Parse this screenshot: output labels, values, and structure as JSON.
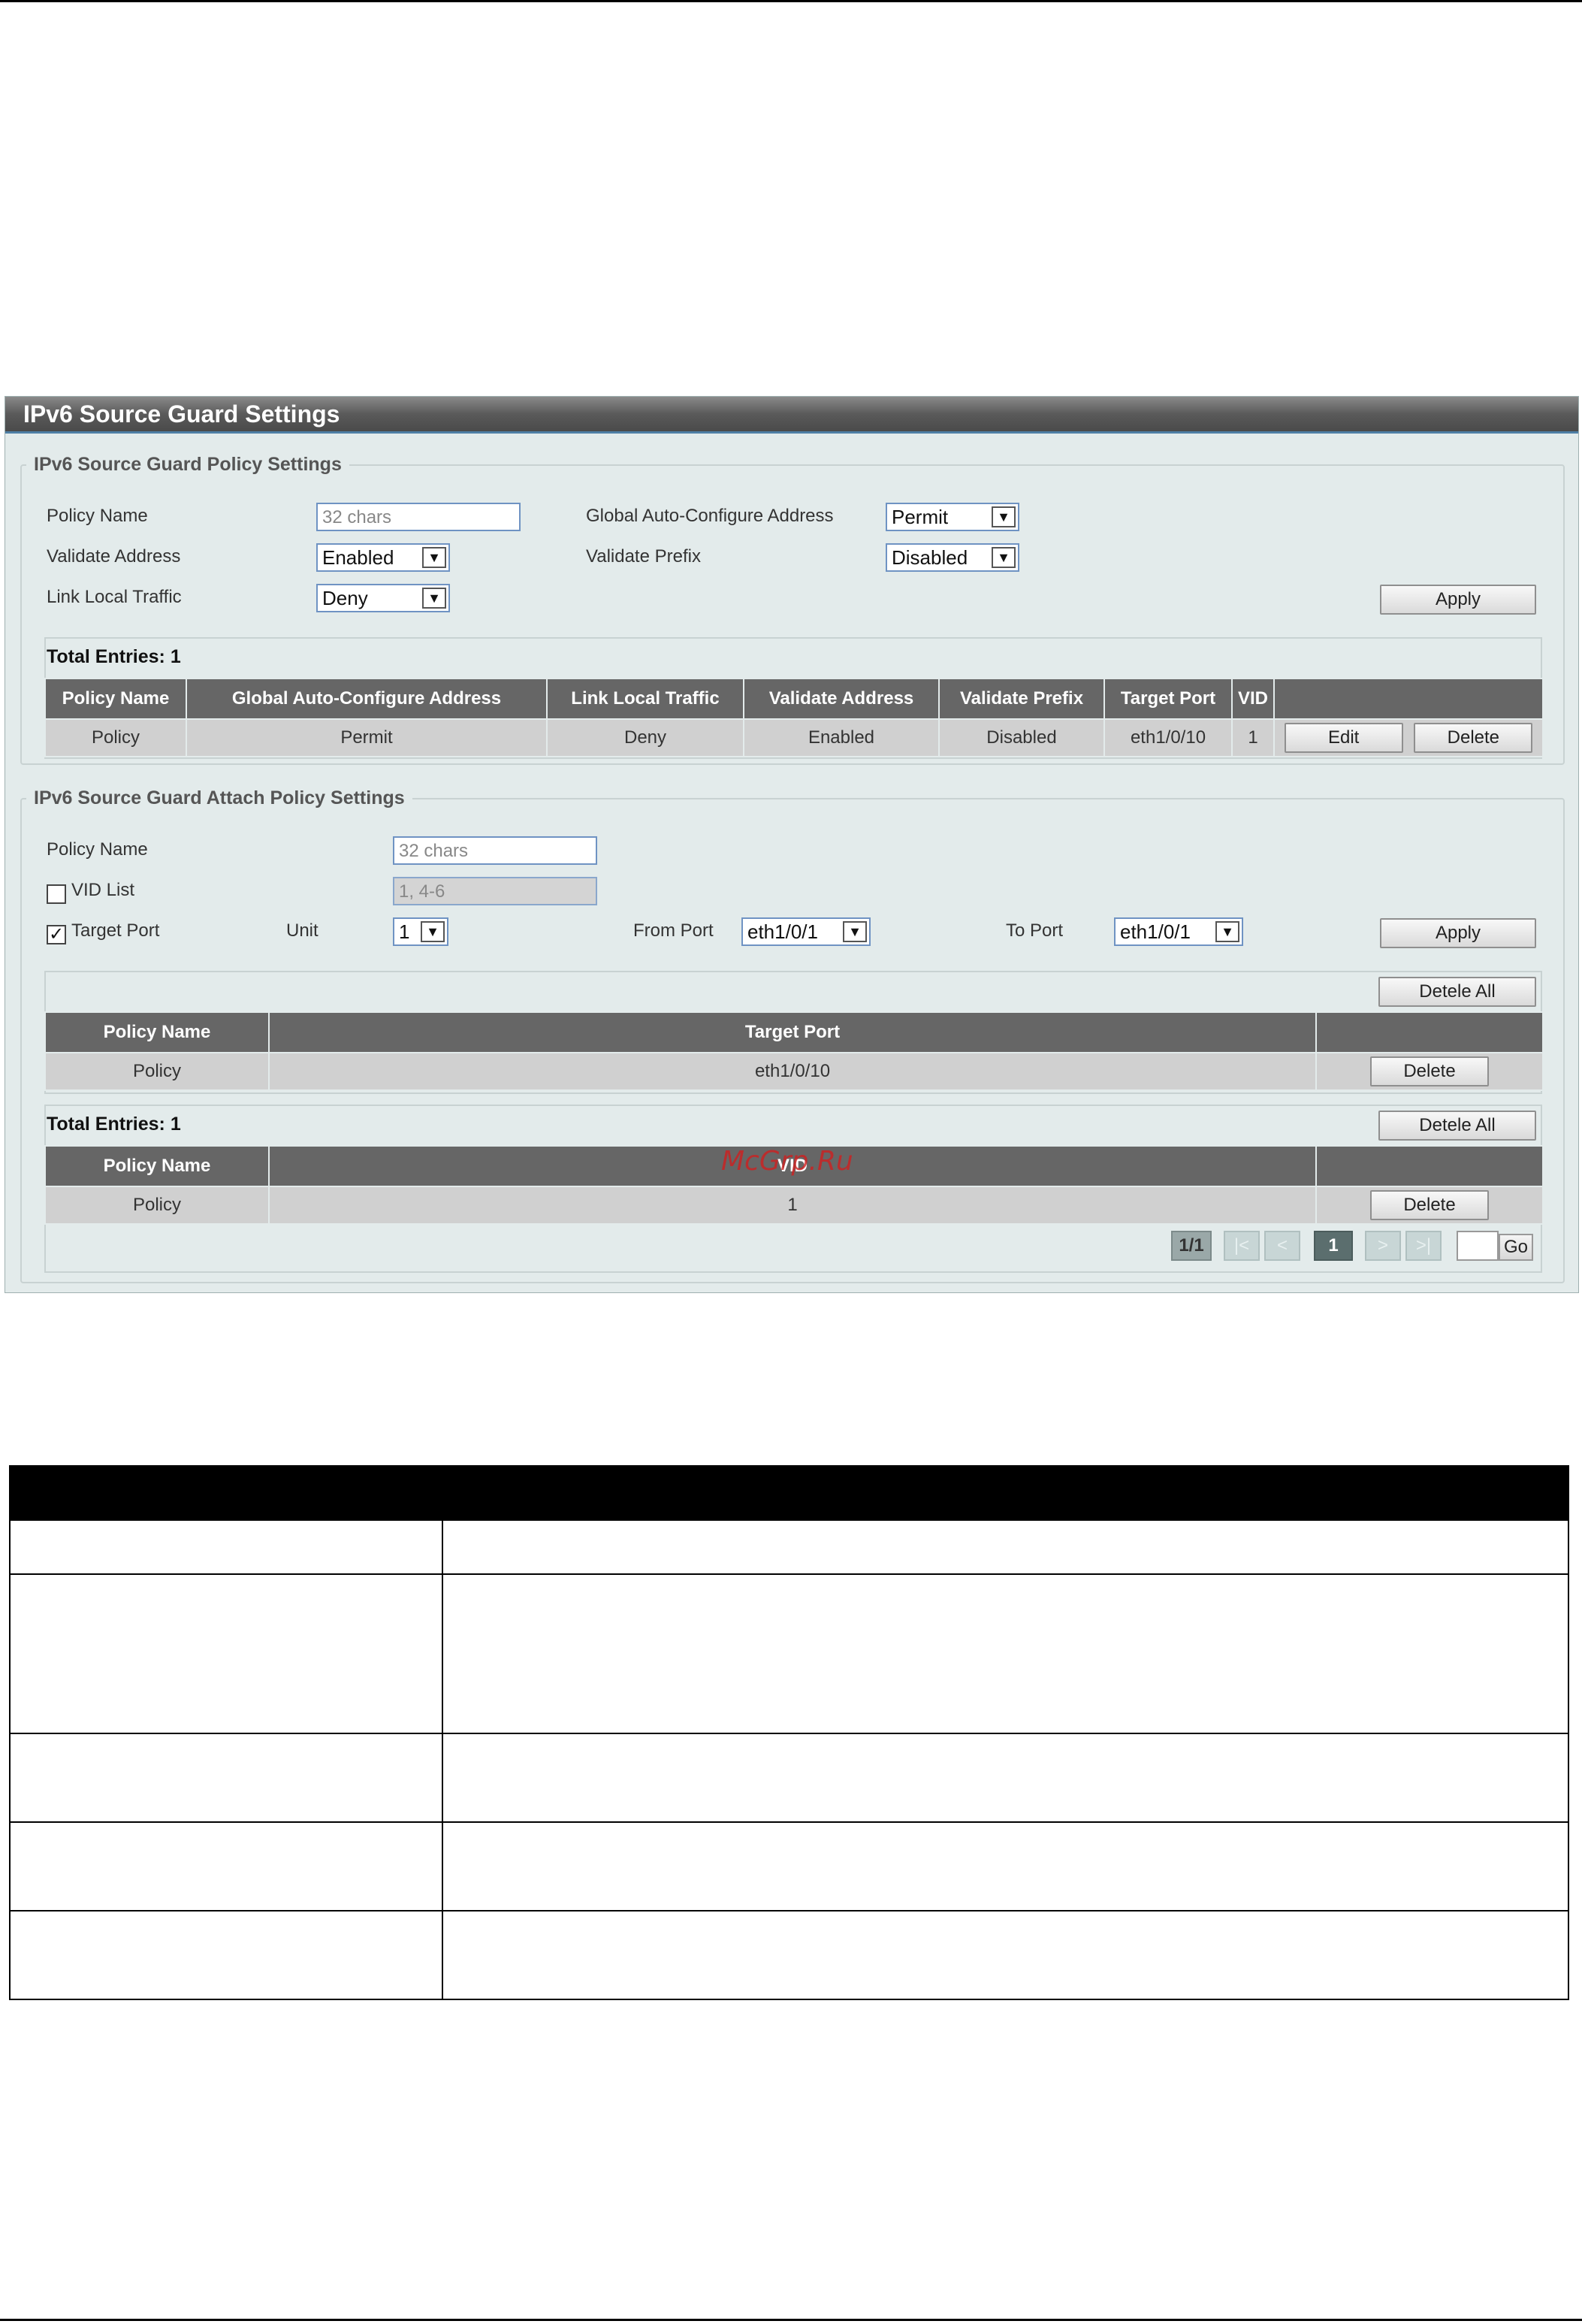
{
  "panel": {
    "title": "IPv6 Source Guard Settings"
  },
  "policy_settings": {
    "legend": "IPv6 Source Guard Policy Settings",
    "policy_name_label": "Policy Name",
    "policy_name_placeholder": "32 chars",
    "global_auto_label": "Global Auto-Configure Address",
    "global_auto_value": "Permit",
    "validate_address_label": "Validate Address",
    "validate_address_value": "Enabled",
    "validate_prefix_label": "Validate Prefix",
    "validate_prefix_value": "Disabled",
    "link_local_label": "Link Local Traffic",
    "link_local_value": "Deny",
    "apply_label": "Apply",
    "total_entries": "Total Entries: 1",
    "table": {
      "headers": [
        "Policy Name",
        "Global Auto-Configure Address",
        "Link Local Traffic",
        "Validate Address",
        "Validate Prefix",
        "Target Port",
        "VID",
        ""
      ],
      "rows": [
        {
          "policy": "Policy",
          "global": "Permit",
          "link_local": "Deny",
          "validate_address": "Enabled",
          "validate_prefix": "Disabled",
          "target_port": "eth1/0/10",
          "vid": "1",
          "edit": "Edit",
          "delete": "Delete"
        }
      ]
    }
  },
  "attach_settings": {
    "legend": "IPv6 Source Guard Attach Policy Settings",
    "policy_name_label": "Policy Name",
    "policy_name_placeholder": "32 chars",
    "vid_list_label": "VID List",
    "vid_list_placeholder": "1, 4-6",
    "vid_list_checked": false,
    "target_port_label": "Target Port",
    "target_port_checked": true,
    "unit_label": "Unit",
    "unit_value": "1",
    "from_port_label": "From Port",
    "from_port_value": "eth1/0/1",
    "to_port_label": "To Port",
    "to_port_value": "eth1/0/1",
    "apply_label": "Apply",
    "delete_all_label": "Detele All",
    "port_table": {
      "headers": [
        "Policy Name",
        "Target Port",
        ""
      ],
      "rows": [
        {
          "policy": "Policy",
          "target_port": "eth1/0/10",
          "delete": "Delete"
        }
      ]
    },
    "total_entries": "Total Entries: 1",
    "delete_all_label_2": "Detele All",
    "vid_table": {
      "headers": [
        "Policy Name",
        "VID",
        ""
      ],
      "rows": [
        {
          "policy": "Policy",
          "vid": "1",
          "delete": "Delete"
        }
      ]
    },
    "pager": {
      "page_info": "1/1",
      "first": "|<",
      "prev": "<",
      "current": "1",
      "next": ">",
      "last": ">|",
      "go_label": "Go"
    }
  },
  "watermark": "McGrp.Ru",
  "colors": {
    "title_bar": "#5a5a5a",
    "panel_bg": "#e3ebeb",
    "table_header": "#666666",
    "table_row": "#d0d0d0",
    "input_border": "#6f93c3",
    "watermark": "#d02020"
  }
}
